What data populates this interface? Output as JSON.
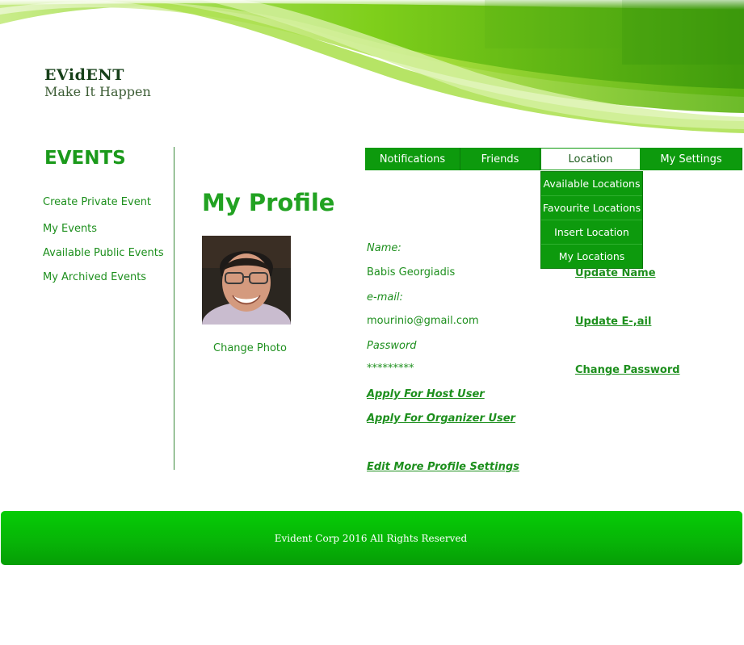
{
  "brand": {
    "title": "EVidENT",
    "tagline": "Make It Happen"
  },
  "sidebar": {
    "title": "EVENTS",
    "items": [
      {
        "label": "Create Private Event"
      },
      {
        "label": "My Events"
      },
      {
        "label": "Available Public Events"
      },
      {
        "label": "My Archived Events"
      }
    ]
  },
  "nav": {
    "items": [
      {
        "label": "Notifications"
      },
      {
        "label": "Friends"
      },
      {
        "label": "Location",
        "active": true
      },
      {
        "label": "My Settings"
      }
    ],
    "location_dropdown": [
      {
        "label": "Available Locations"
      },
      {
        "label": "Favourite Locations"
      },
      {
        "label": "Insert Location"
      },
      {
        "label": "My Locations"
      }
    ]
  },
  "profile": {
    "page_title": "My Profile",
    "change_photo": "Change Photo",
    "name_label": "Name:",
    "name_value": "Babis Georgiadis",
    "email_label": "e-mail:",
    "email_value": "mourinio@gmail.com",
    "password_label": "Password",
    "password_value": "*********",
    "apply_host": "Apply For Host User",
    "apply_organizer": "Apply For Organizer User",
    "edit_more": "Edit More Profile Settings",
    "update_name": "Update Name",
    "update_email": "Update E-,ail",
    "change_password": "Change Password"
  },
  "footer": {
    "text": "Evident Corp  2016 All Rights Reserved"
  },
  "colors": {
    "accent_green": "#0d9a0d",
    "text_green": "#1d8f1d",
    "footer_green": "#07b507"
  }
}
